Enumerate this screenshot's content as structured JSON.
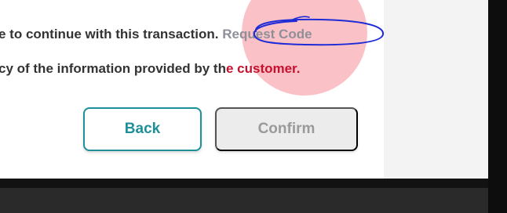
{
  "message": {
    "line1_text": "e to continue with this transaction.",
    "request_code_link": "Request Code",
    "line2_prefix": "cy of the information provided by th",
    "line2_highlight": "e customer."
  },
  "buttons": {
    "back_label": "Back",
    "confirm_label": "Confirm"
  },
  "colors": {
    "accent": "#1f8f98",
    "link_muted": "#8f8f9a",
    "warning_red": "#c8102e",
    "highlight_circle": "#f8aab0",
    "annotation_ink": "#1f2bd6",
    "disabled_bg": "#ececec"
  }
}
